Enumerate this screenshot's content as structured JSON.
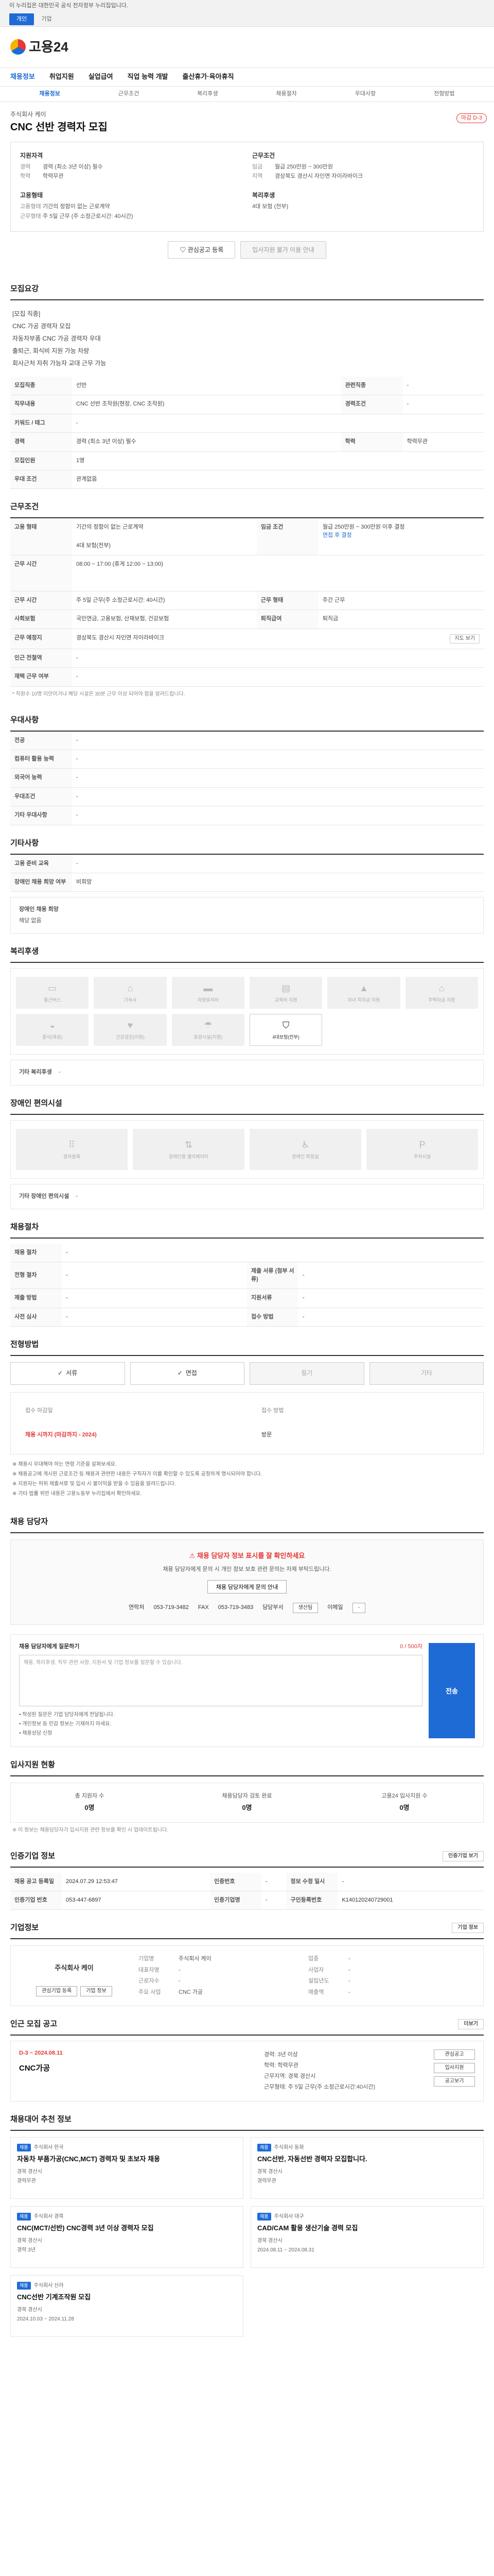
{
  "gov_banner": "이 누리집은 대한민국 공식 전자정부 누리집입니다.",
  "gov_tabs": [
    "개인",
    "기업"
  ],
  "site": {
    "logo_text": "고용24"
  },
  "gnb": [
    "채용정보",
    "취업지원",
    "실업급여",
    "직업 능력 개발",
    "출산휴가·육아휴직"
  ],
  "subnav": [
    "채용정보",
    "근무조건",
    "복리후생",
    "채용절차",
    "우대사항",
    "전형방법"
  ],
  "job": {
    "company": "주식회사 케이",
    "title": "CNC 선반 경력자 모집",
    "dday": "마감 D-3"
  },
  "summary": {
    "qual_title": "지원자격",
    "qual": [
      [
        "경력",
        "경력 (최소 3년 이상) 필수"
      ],
      [
        "학력",
        "학력무관"
      ]
    ],
    "cond_title": "근무조건",
    "cond": [
      [
        "임금",
        "월급 250만원 ~ 300만원"
      ],
      [
        "지역",
        "경상북도 경산시 자인면 자이라바이크"
      ]
    ],
    "form_title": "고용형태",
    "form": [
      [
        "고용형태",
        "기간의 정함이 없는 근로계약"
      ],
      [
        "근무형태",
        "주 5일 근무 (주 소정근로시간: 40시간)"
      ]
    ],
    "welfare_title": "복리후생",
    "welfare": "4대 보험 (전부)"
  },
  "actions": {
    "interest": "관심공고 등록",
    "apply_similar": "입사지원 불가 이용 안내"
  },
  "section_recruit": {
    "title": "모집요강",
    "desc_lines": [
      "[모집 직종]",
      "CNC 가공 경력자 모집",
      "자동차부품 CNC 가공 경력자 우대",
      "출퇴근, 회식비 지원 가능 차량",
      "회사근처 자취 가능자 교대 근무 가능"
    ],
    "rows": [
      [
        "모집직종",
        "선반",
        "관련직종",
        "-"
      ],
      [
        "직무내용",
        "CNC 선반 조작원(현장, CNC 조작원)",
        "경력조건",
        "-"
      ],
      [
        "키워드 / 태그",
        "-",
        "",
        ""
      ],
      [
        "경력",
        "경력 (최소 3년 이상) 필수",
        "학력",
        "학력무관"
      ],
      [
        "모집인원",
        "1명",
        "",
        ""
      ]
    ],
    "etc_label": "우대 조건",
    "etc_value": "관계없음"
  },
  "section_cond": {
    "title": "근무조건",
    "employ_label": "고용 형태",
    "employ_value": "기간의 정함이 없는 근로계약",
    "pay_label": "임금 조건",
    "pay_value": "월급 250만원 ~ 300만원 이후 결정",
    "pay_link": "면접 후 결정",
    "insurance": "4대 보험(전부)",
    "hours_label": "근무 시간",
    "hours_value": "08:00 ~ 17:00 (휴게 12:00 ~ 13:00)",
    "rows": [
      [
        "근무 시간",
        "주 5일 근무(주 소정근로시간: 40시간)",
        "근무 형태",
        "주간 근무"
      ],
      [
        "사회보험",
        "국민연금, 고용보험, 산재보험, 건강보험",
        "퇴직급여",
        "퇴직금"
      ],
      [
        "근무 예정지",
        "경상북도 경산시 자인면 자이라바이크",
        "",
        ""
      ],
      [
        "인근 전철역",
        "-",
        "",
        ""
      ],
      [
        "재택 근무 여부",
        "-",
        "",
        ""
      ]
    ],
    "map_chip": "지도 보기",
    "note": "* 직원수 10명 미만이거나 해당 시설은 30분 근무 이상 되어야 함을 알려드립니다."
  },
  "section_pref": {
    "title": "우대사항",
    "rows": [
      [
        "전공",
        "-"
      ],
      [
        "컴퓨터 활용 능력",
        "-"
      ],
      [
        "외국어 능력",
        "-"
      ],
      [
        "우대조건",
        "-"
      ],
      [
        "기타 우대사항",
        "-"
      ]
    ]
  },
  "section_etc": {
    "title": "기타사항",
    "rows": [
      [
        "고용 준비 교육",
        "-"
      ],
      [
        "장애인 채용 희망 여부",
        "비희망"
      ]
    ]
  },
  "section_disability": {
    "title": "장애인 채용 희망",
    "value": "해당 없음"
  },
  "section_welfare": {
    "title": "복리후생",
    "items": [
      {
        "label": "통근버스",
        "icon": "bus-icon",
        "on": false
      },
      {
        "label": "기숙사",
        "icon": "home-icon",
        "on": false
      },
      {
        "label": "차량유지비",
        "icon": "car-icon",
        "on": false
      },
      {
        "label": "교육비 지원",
        "icon": "book-icon",
        "on": false
      },
      {
        "label": "자녀 학자금 지원",
        "icon": "cap-icon",
        "on": false
      },
      {
        "label": "주택자금 지원",
        "icon": "house-icon",
        "on": false
      },
      {
        "label": "중식(제공)",
        "icon": "meal-icon",
        "on": false
      },
      {
        "label": "건강검진(지원)",
        "icon": "heart-icon",
        "on": false
      },
      {
        "label": "휴양시설(지원)",
        "icon": "umbrella-icon",
        "on": false
      },
      {
        "label": "4대보험(전부)",
        "icon": "shield-icon",
        "on": true
      }
    ],
    "other_label": "기타 복리후생",
    "other_value": "-"
  },
  "section_facility": {
    "title": "장애인 편의시설",
    "items": [
      {
        "label": "점자블록",
        "icon": "braille-icon"
      },
      {
        "label": "장애인용 엘리베이터",
        "icon": "elevator-icon"
      },
      {
        "label": "장애인 화장실",
        "icon": "toilet-icon"
      },
      {
        "label": "주차시설",
        "icon": "parking-icon"
      }
    ],
    "other_label": "기타 장애인 편의시설",
    "other_value": "-"
  },
  "section_process": {
    "title": "채용절차",
    "rows": [
      [
        "채용 절차",
        "-",
        "",
        ""
      ],
      [
        "전형 절차",
        "-",
        "제출 서류 (첨부 서류)",
        "-"
      ],
      [
        "제출 방법",
        "-",
        "지원서류",
        "-"
      ],
      [
        "사전 심사",
        "-",
        "접수 방법",
        "-"
      ]
    ]
  },
  "section_method": {
    "title": "전형방법",
    "methods": [
      {
        "label": "서류",
        "on": true
      },
      {
        "label": "면접",
        "on": true
      },
      {
        "label": "필기",
        "on": false
      },
      {
        "label": "기타",
        "on": false
      }
    ],
    "submit_period_label": "접수 마감일",
    "submit_period": "채용 시까지 (마감까지 - 2024)",
    "submit_method_label": "접수 방법",
    "submit_method": "방문"
  },
  "fine_print": [
    "※ 채용시 우대해야 하는 연령 기준을 살펴보세요.",
    "※ 채용공고에 게시된 근로조건 등 채용과 관련한 내용은 구직자가 이를 확인할 수 있도록 공정하게 명시되어야 합니다.",
    "※ 지원자는 허위 제출서류 및 입사 시 불이익을 받을 수 있음을 알려드립니다.",
    "※ 기타 법률 위반 내용은 고용노동부 누리집에서 확인하세요."
  ],
  "section_manager": {
    "title": "채용 담당자",
    "notice_title": "채용 담당자 정보 표시를 잘 확인하세요",
    "notice_text": "채용 담당자에게 문의 시 개인 정보 보호 관련 문의는 자제 부탁드립니다.",
    "notice_btn": "채용 담당자에게 문의 안내",
    "contact_label": "연락처",
    "contact_value": "053-719-3482",
    "fax_label": "FAX",
    "fax_value": "053-719-3483",
    "dept_label": "담당부서",
    "dept_value": "생산팀",
    "email_label": "이메일",
    "email_value": "-"
  },
  "inquiry": {
    "title": "채용 담당자에게 질문하기",
    "count_label": "0 / 500자",
    "placeholder": "채용, 복리후생, 직무 관련 사항, 지원서 및 기업 정보를 질문할 수 있습니다.",
    "notes": [
      "• 작성된 질문은 기업 담당자에게 전달됩니다.",
      "• 개인정보 등 민감 정보는 기재하지 마세요.",
      "• 채용상담 신청"
    ],
    "send": "전송"
  },
  "section_stats": {
    "title": "입사지원 현황",
    "items": [
      {
        "label": "총 지원자 수",
        "value": "0명"
      },
      {
        "label": "채용담당자 검토 완료",
        "value": "0명"
      },
      {
        "label": "고용24 입사지원 수",
        "value": "0명"
      }
    ],
    "note": "※ 이 정보는 채용담당자가 입사지원 관련 정보를 확인 시 업데이트됩니다."
  },
  "section_reg": {
    "title": "인증기업 정보",
    "btn": "인증기업 보기",
    "rows": [
      [
        "채용 공고 등록일",
        "2024.07.29 12:53:47",
        "인증번호",
        "-",
        "정보 수정 일시",
        "-"
      ],
      [
        "인증기업 번호",
        "053-447-6897",
        "인증기업명",
        "-",
        "구인등록번호",
        "K140120240729001"
      ]
    ]
  },
  "section_enterprise": {
    "title": "기업정보",
    "btn": "기업 정보",
    "logo": "주식회사 케이",
    "btns": [
      "관심기업 등록",
      "기업 정보"
    ],
    "grid": [
      [
        "기업명",
        "주식회사 케이",
        "업종",
        "-"
      ],
      [
        "대표자명",
        "-",
        "사업자",
        "-"
      ],
      [
        "근로자수",
        "-",
        "설립년도",
        "-"
      ],
      [
        "주요 사업",
        "CNC 가공",
        "매출액",
        "-"
      ]
    ]
  },
  "section_nearby": {
    "title": "인근 모집 공고",
    "btn": "더보기",
    "card": {
      "dday": "D-3  ~ 2024.08.11",
      "title": "CNC가공",
      "mid": [
        "경력: 3년 이상",
        "학력: 학력무관",
        "근무지역: 경북 경산시",
        "근무형태: 주 5일 근무(주 소정근로시간:40시간)"
      ],
      "btns": [
        "관심공고",
        "입사지원",
        "공고보기"
      ]
    }
  },
  "section_recommend": {
    "title": "채용대어 추천 정보",
    "cards": [
      {
        "tag": "채용",
        "company": "주식회사 한국",
        "title": "자동차 부품가공(CNC,MCT) 경력자 및 초보자 채용",
        "meta": [
          "경북 경산시",
          "경력무관"
        ]
      },
      {
        "tag": "채용",
        "company": "주식회사 동화",
        "title": "CNC선반, 자동선반 경력자 모집합니다.",
        "meta": [
          "경북 경산시",
          "경력무관"
        ]
      },
      {
        "tag": "채용",
        "company": "주식회사 경북",
        "title": "CNC(MCT/선반) CNC경력 3년 이상 경력자 모집",
        "meta": [
          "경북 경산시",
          "경력 3년"
        ]
      },
      {
        "tag": "채용",
        "company": "주식회사 대구",
        "title": "CAD/CAM 활용 생산기술 경력 모집",
        "meta": [
          "경북 경산시",
          "2024.08.11 ~ 2024.08.31"
        ]
      },
      {
        "tag": "채용",
        "company": "주식회사 신라",
        "title": "CNC선반 기계조작원 모집",
        "meta": [
          "경북 경산시",
          "2024.10.03 ~ 2024.11.28"
        ]
      }
    ]
  }
}
